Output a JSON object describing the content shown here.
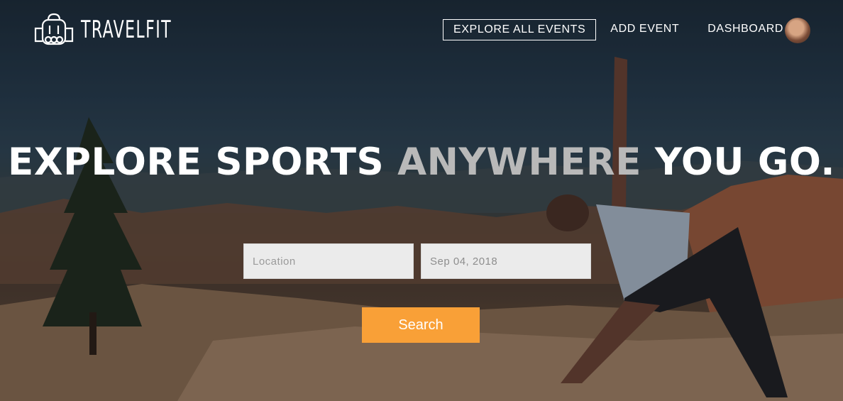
{
  "brand": {
    "name": "TRAVELFIT",
    "logo_icon": "backpack-icon"
  },
  "nav": {
    "items": [
      {
        "label": "EXPLORE ALL EVENTS",
        "active": true
      },
      {
        "label": "ADD EVENT",
        "active": false
      },
      {
        "label": "DASHBOARD",
        "active": false
      }
    ],
    "avatar_icon": "user-avatar"
  },
  "hero": {
    "headline_part1": "EXPLORE SPORTS ",
    "headline_highlight": "ANYWHERE",
    "headline_part2": " YOU GO."
  },
  "search": {
    "location_placeholder": "Location",
    "location_value": "",
    "date_value": "Sep 04, 2018",
    "button_label": "Search"
  },
  "colors": {
    "accent": "#f9a037",
    "highlight_text": "#b9b9b9"
  }
}
